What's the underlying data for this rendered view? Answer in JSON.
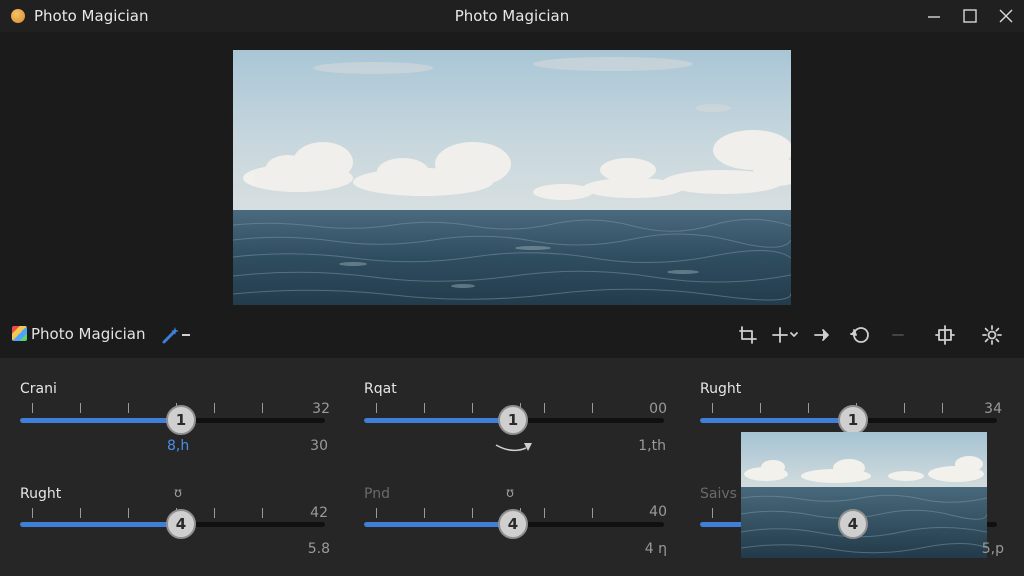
{
  "window": {
    "app_name": "Photo Magician",
    "title": "Photo Magician"
  },
  "toolbar": {
    "app_name": "Photo Magician"
  },
  "controls": [
    {
      "label": "Crani",
      "value_right": "32",
      "knob": "1",
      "sub_value": "8,h",
      "sub_value2": "30",
      "fill": 0.53
    },
    {
      "label": "Rqat",
      "value_right": "00",
      "knob": "1",
      "sub_value": "1,th",
      "fill": 0.53
    },
    {
      "label": "Rught",
      "value_right": "34",
      "knob": "1",
      "fill": 0.52
    },
    {
      "label": "Rught",
      "value_right": "42",
      "knob": "4",
      "sub_value": "5.8",
      "icon_text": "ʊ",
      "fill": 0.53
    },
    {
      "label": "Pnd",
      "value_right": "40",
      "knob": "4",
      "sub_value": "4 η",
      "icon_text": "ʊ",
      "fill": 0.53
    },
    {
      "label": "Saivs",
      "knob": "4",
      "sub_value": "5,p",
      "fill": 0.52
    }
  ],
  "colors": {
    "accent": "#3f7fd8",
    "panel_bg": "#262626",
    "window_bg": "#1b1b1b"
  }
}
